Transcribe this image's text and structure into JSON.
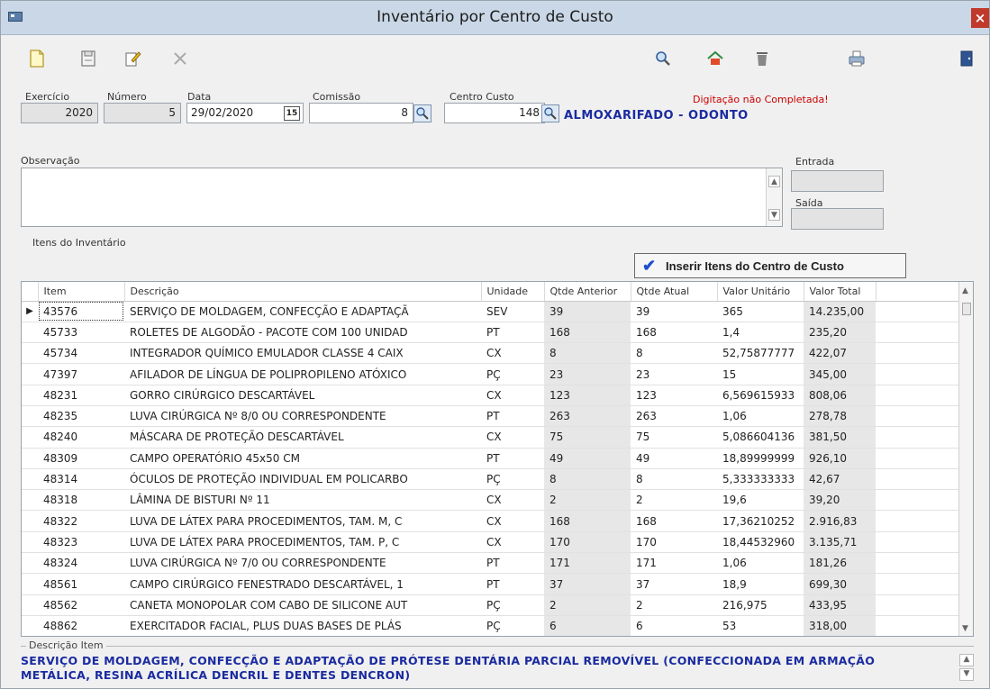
{
  "window": {
    "title": "Inventário por Centro de Custo",
    "close_label": "×"
  },
  "toolbar": {
    "icons": [
      "new-document-icon",
      "save-icon",
      "edit-icon",
      "cancel-icon",
      "search-icon",
      "home-icon",
      "delete-icon",
      "print-icon",
      "exit-icon"
    ]
  },
  "form": {
    "exercicio_label": "Exercício",
    "exercicio_value": "2020",
    "numero_label": "Número",
    "numero_value": "5",
    "data_label": "Data",
    "data_value": "29/02/2020",
    "calendar_label": "15",
    "comissao_label": "Comissão",
    "comissao_value": "8",
    "centro_custo_label": "Centro Custo",
    "centro_custo_value": "148",
    "centro_custo_name": "ALMOXARIFADO - ODONTO",
    "status_warning": "Digitação não Completada!",
    "observacao_label": "Observação",
    "entrada_label": "Entrada",
    "saida_label": "Saída",
    "itens_label": "Itens do Inventário"
  },
  "insert_button": {
    "label": "Inserir Itens do Centro de Custo"
  },
  "grid": {
    "columns": [
      "Item",
      "Descrição",
      "Unidade",
      "Qtde Anterior",
      "Qtde Atual",
      "Valor Unitário",
      "Valor Total"
    ],
    "rows": [
      {
        "item": "43576",
        "descricao": "SERVIÇO DE MOLDAGEM, CONFECÇÃO E ADAPTAÇÃ",
        "unidade": "SEV",
        "qtde_anterior": "39",
        "qtde_atual": "39",
        "valor_unitario": "365",
        "valor_total": "14.235,00"
      },
      {
        "item": "45733",
        "descricao": "ROLETES DE ALGODÃO - PACOTE COM 100 UNIDAD",
        "unidade": "PT",
        "qtde_anterior": "168",
        "qtde_atual": "168",
        "valor_unitario": "1,4",
        "valor_total": "235,20"
      },
      {
        "item": "45734",
        "descricao": "INTEGRADOR QUÍMICO EMULADOR CLASSE 4 CAIX",
        "unidade": "CX",
        "qtde_anterior": "8",
        "qtde_atual": "8",
        "valor_unitario": "52,75877777",
        "valor_total": "422,07"
      },
      {
        "item": "47397",
        "descricao": "AFILADOR DE LÍNGUA DE POLIPROPILENO ATÓXICO",
        "unidade": "PÇ",
        "qtde_anterior": "23",
        "qtde_atual": "23",
        "valor_unitario": "15",
        "valor_total": "345,00"
      },
      {
        "item": "48231",
        "descricao": "GORRO CIRÚRGICO DESCARTÁVEL",
        "unidade": "CX",
        "qtde_anterior": "123",
        "qtde_atual": "123",
        "valor_unitario": "6,569615933",
        "valor_total": "808,06"
      },
      {
        "item": "48235",
        "descricao": "LUVA CIRÚRGICA Nº 8/0 OU CORRESPONDENTE",
        "unidade": "PT",
        "qtde_anterior": "263",
        "qtde_atual": "263",
        "valor_unitario": "1,06",
        "valor_total": "278,78"
      },
      {
        "item": "48240",
        "descricao": "MÁSCARA DE PROTEÇÃO DESCARTÁVEL",
        "unidade": "CX",
        "qtde_anterior": "75",
        "qtde_atual": "75",
        "valor_unitario": "5,086604136",
        "valor_total": "381,50"
      },
      {
        "item": "48309",
        "descricao": "CAMPO OPERATÓRIO 45x50 CM",
        "unidade": "PT",
        "qtde_anterior": "49",
        "qtde_atual": "49",
        "valor_unitario": "18,89999999",
        "valor_total": "926,10"
      },
      {
        "item": "48314",
        "descricao": "ÓCULOS DE PROTEÇÃO INDIVIDUAL EM POLICARBO",
        "unidade": "PÇ",
        "qtde_anterior": "8",
        "qtde_atual": "8",
        "valor_unitario": "5,333333333",
        "valor_total": "42,67"
      },
      {
        "item": "48318",
        "descricao": "LÂMINA DE BISTURI Nº 11",
        "unidade": "CX",
        "qtde_anterior": "2",
        "qtde_atual": "2",
        "valor_unitario": "19,6",
        "valor_total": "39,20"
      },
      {
        "item": "48322",
        "descricao": "LUVA DE LÁTEX PARA PROCEDIMENTOS, TAM. M, C",
        "unidade": "CX",
        "qtde_anterior": "168",
        "qtde_atual": "168",
        "valor_unitario": "17,36210252",
        "valor_total": "2.916,83"
      },
      {
        "item": "48323",
        "descricao": "LUVA DE LÁTEX PARA PROCEDIMENTOS, TAM. P, C",
        "unidade": "CX",
        "qtde_anterior": "170",
        "qtde_atual": "170",
        "valor_unitario": "18,44532960",
        "valor_total": "3.135,71"
      },
      {
        "item": "48324",
        "descricao": "LUVA CIRÚRGICA Nº 7/0 OU CORRESPONDENTE",
        "unidade": "PT",
        "qtde_anterior": "171",
        "qtde_atual": "171",
        "valor_unitario": "1,06",
        "valor_total": "181,26"
      },
      {
        "item": "48561",
        "descricao": "CAMPO CIRÚRGICO FENESTRADO DESCARTÁVEL, 1",
        "unidade": "PT",
        "qtde_anterior": "37",
        "qtde_atual": "37",
        "valor_unitario": "18,9",
        "valor_total": "699,30"
      },
      {
        "item": "48562",
        "descricao": "CANETA MONOPOLAR COM CABO DE SILICONE AUT",
        "unidade": "PÇ",
        "qtde_anterior": "2",
        "qtde_atual": "2",
        "valor_unitario": "216,975",
        "valor_total": "433,95"
      },
      {
        "item": "48862",
        "descricao": "EXERCITADOR FACIAL, PLUS DUAS BASES DE PLÁS",
        "unidade": "PÇ",
        "qtde_anterior": "6",
        "qtde_atual": "6",
        "valor_unitario": "53",
        "valor_total": "318,00"
      }
    ]
  },
  "descricao_item": {
    "label": "Descrição Item",
    "text": "SERVIÇO DE MOLDAGEM, CONFECÇÃO E ADAPTAÇÃO DE PRÓTESE DENTÁRIA PARCIAL REMOVÍVEL (CONFECCIONADA EM ARMAÇÃO METÁLICA, RESINA ACRÍLICA DENCRIL E DENTES DENCRON)"
  }
}
